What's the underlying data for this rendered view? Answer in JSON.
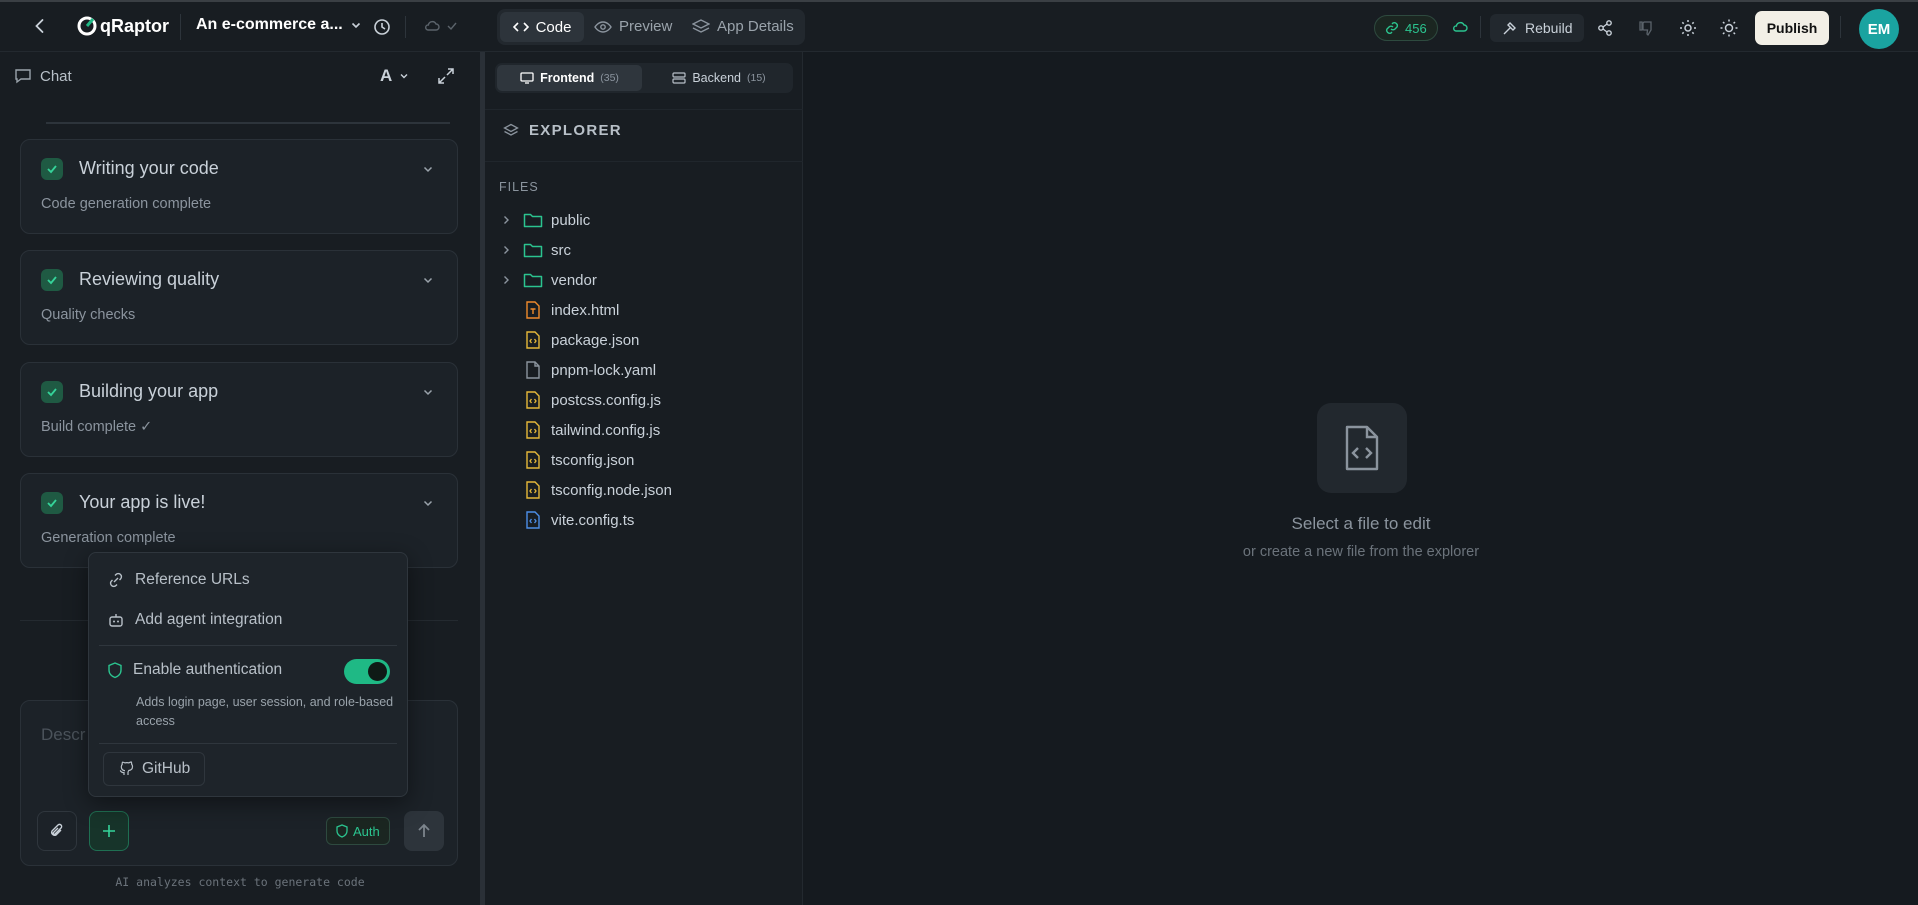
{
  "topbar": {
    "brand": "qRaptor",
    "project_title": "An e-commerce a...",
    "tabs": [
      {
        "label": "Code",
        "active": true
      },
      {
        "label": "Preview",
        "active": false
      },
      {
        "label": "App Details",
        "active": false
      }
    ],
    "credits": "456",
    "rebuild_label": "Rebuild",
    "publish_label": "Publish",
    "avatar_initials": "EM"
  },
  "chat": {
    "header_label": "Chat",
    "font_label": "A",
    "steps": [
      {
        "title": "Writing your code",
        "subtitle": "Code generation complete"
      },
      {
        "title": "Reviewing quality",
        "subtitle": "Quality checks"
      },
      {
        "title": "Building your app",
        "subtitle": "Build complete ✓"
      },
      {
        "title": "Your app is live!",
        "subtitle": "Generation complete"
      }
    ],
    "input_placeholder": "Descr",
    "auth_badge": "Auth",
    "footer_note": "AI analyzes context to generate code"
  },
  "popup": {
    "reference_urls": "Reference URLs",
    "add_agent": "Add agent integration",
    "enable_auth": "Enable authentication",
    "enable_auth_desc": "Adds login page, user session, and role-based access",
    "auth_enabled": true,
    "github": "GitHub"
  },
  "explorer": {
    "tab_frontend": "Frontend",
    "tab_frontend_count": "(35)",
    "tab_backend": "Backend",
    "tab_backend_count": "(15)",
    "title": "EXPLORER",
    "section": "FILES",
    "items": [
      {
        "name": "public",
        "type": "folder"
      },
      {
        "name": "src",
        "type": "folder"
      },
      {
        "name": "vendor",
        "type": "folder"
      },
      {
        "name": "index.html",
        "type": "html"
      },
      {
        "name": "package.json",
        "type": "json"
      },
      {
        "name": "pnpm-lock.yaml",
        "type": "file"
      },
      {
        "name": "postcss.config.js",
        "type": "json"
      },
      {
        "name": "tailwind.config.js",
        "type": "json"
      },
      {
        "name": "tsconfig.json",
        "type": "json"
      },
      {
        "name": "tsconfig.node.json",
        "type": "json"
      },
      {
        "name": "vite.config.ts",
        "type": "ts"
      }
    ]
  },
  "editor": {
    "empty_title": "Select a file to edit",
    "empty_sub": "or create a new file from the explorer"
  },
  "colors": {
    "accent": "#1fb985",
    "folder": "#2bc48f",
    "json_file": "#e5b83a",
    "html_file": "#ef8a2c",
    "ts_file": "#4c8ee8"
  }
}
